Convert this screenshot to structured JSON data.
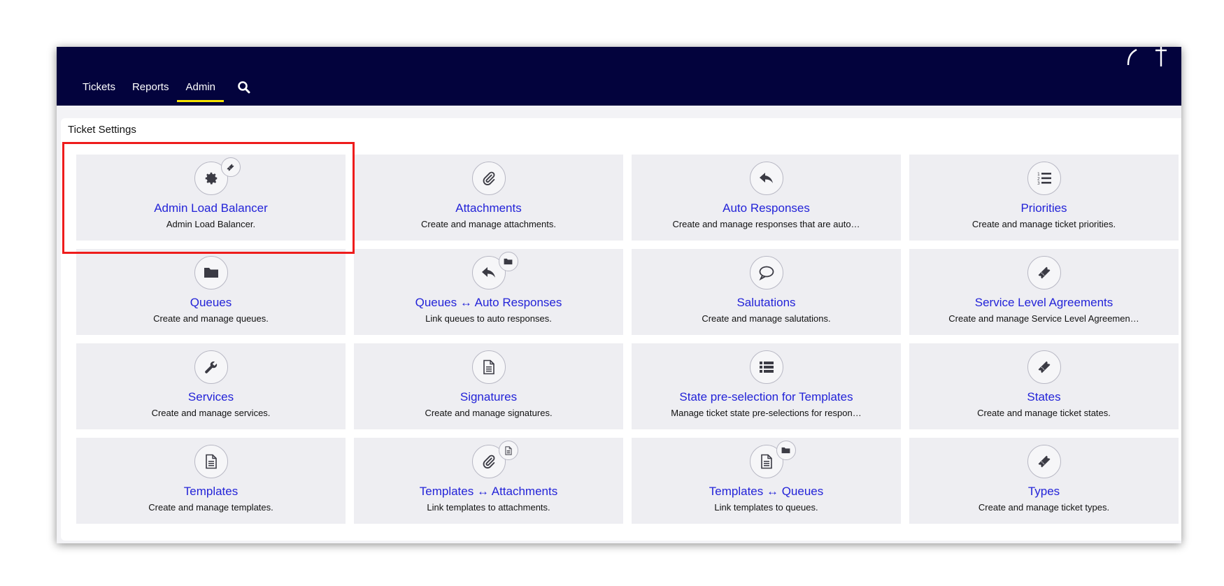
{
  "nav": {
    "items": [
      {
        "label": "Tickets",
        "active": false
      },
      {
        "label": "Reports",
        "active": false
      },
      {
        "label": "Admin",
        "active": true
      }
    ],
    "search_icon": "search-icon",
    "accent_color": "#f5e200",
    "bar_color": "#03033d"
  },
  "panel": {
    "title": "Ticket Settings"
  },
  "tiles": [
    {
      "title": "Admin Load Balancer",
      "desc": "Admin Load Balancer.",
      "icon": "gear-icon",
      "badge": "ticket-icon"
    },
    {
      "title": "Attachments",
      "desc": "Create and manage attachments.",
      "icon": "paperclip-icon"
    },
    {
      "title": "Auto Responses",
      "desc": "Create and manage responses that are auto…",
      "icon": "reply-icon"
    },
    {
      "title": "Priorities",
      "desc": "Create and manage ticket priorities.",
      "icon": "numbered-list-icon"
    },
    {
      "title": "Queues",
      "desc": "Create and manage queues.",
      "icon": "folder-icon"
    },
    {
      "title": "Queues ↔ Auto Responses",
      "desc": "Link queues to auto responses.",
      "icon": "reply-icon",
      "badge": "folder-icon"
    },
    {
      "title": "Salutations",
      "desc": "Create and manage salutations.",
      "icon": "speech-bubble-icon"
    },
    {
      "title": "Service Level Agreements",
      "desc": "Create and manage Service Level Agreemen…",
      "icon": "ticket-icon"
    },
    {
      "title": "Services",
      "desc": "Create and manage services.",
      "icon": "wrench-icon"
    },
    {
      "title": "Signatures",
      "desc": "Create and manage signatures.",
      "icon": "document-icon"
    },
    {
      "title": "State pre-selection for Templates",
      "desc": "Manage ticket state pre-selections for respon…",
      "icon": "list-icon"
    },
    {
      "title": "States",
      "desc": "Create and manage ticket states.",
      "icon": "ticket-icon"
    },
    {
      "title": "Templates",
      "desc": "Create and manage templates.",
      "icon": "document-icon"
    },
    {
      "title": "Templates ↔ Attachments",
      "desc": "Link templates to attachments.",
      "icon": "paperclip-icon",
      "badge": "document-icon"
    },
    {
      "title": "Templates ↔ Queues",
      "desc": "Link templates to queues.",
      "icon": "document-icon",
      "badge": "folder-icon"
    },
    {
      "title": "Types",
      "desc": "Create and manage ticket types.",
      "icon": "ticket-icon"
    }
  ],
  "highlight_color": "#ee1c1c"
}
